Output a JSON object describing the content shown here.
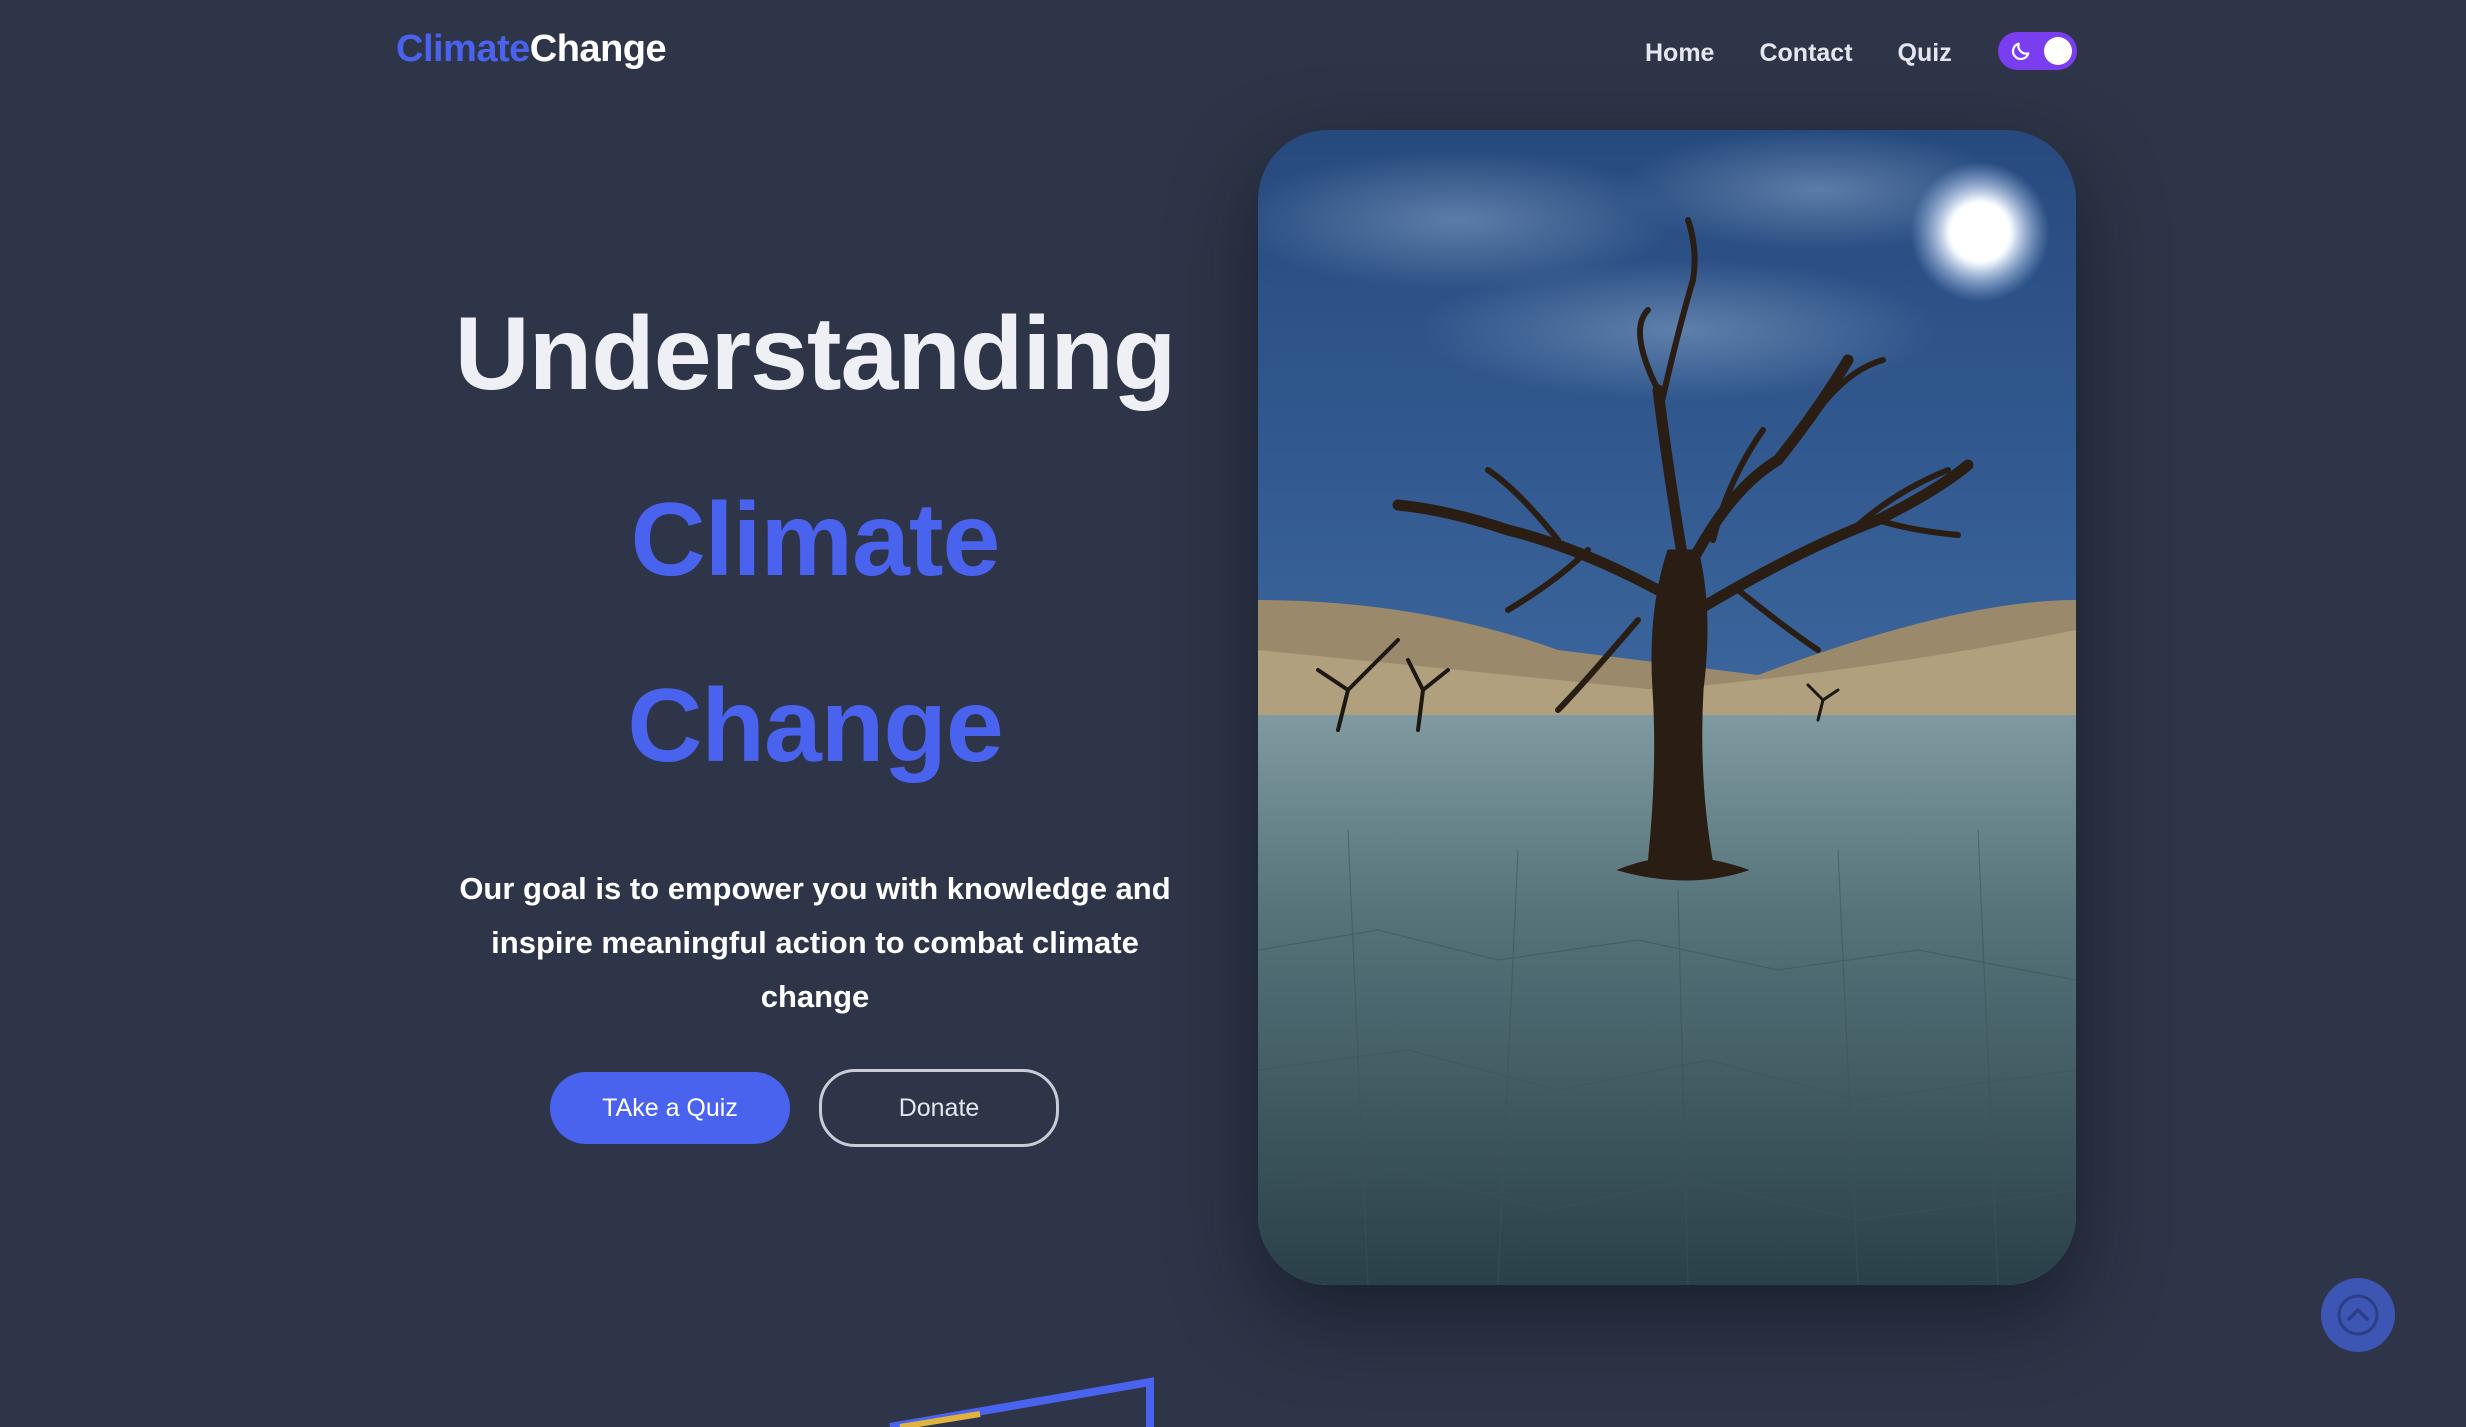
{
  "header": {
    "logo_part1": "Climate",
    "logo_part2": "Change",
    "nav": [
      {
        "label": "Home"
      },
      {
        "label": "Contact"
      },
      {
        "label": "Quiz"
      }
    ],
    "theme_toggle": {
      "icon": "moon-icon",
      "state": "dark"
    }
  },
  "hero": {
    "title_line1": "Understanding",
    "title_line2": "Climate",
    "title_line3": "Change",
    "description": "Our goal is to empower you with knowledge and inspire meaningful action to combat climate change",
    "primary_button": "TAke a Quiz",
    "secondary_button": "Donate",
    "image": "dead-tree-desert-moonlight"
  },
  "scroll_top": {
    "icon": "chevron-up-circle-icon"
  },
  "colors": {
    "background": "#2e3548",
    "accent": "#4a63ee",
    "toggle": "#7a3df0",
    "scroll_button": "#3d56b4"
  }
}
